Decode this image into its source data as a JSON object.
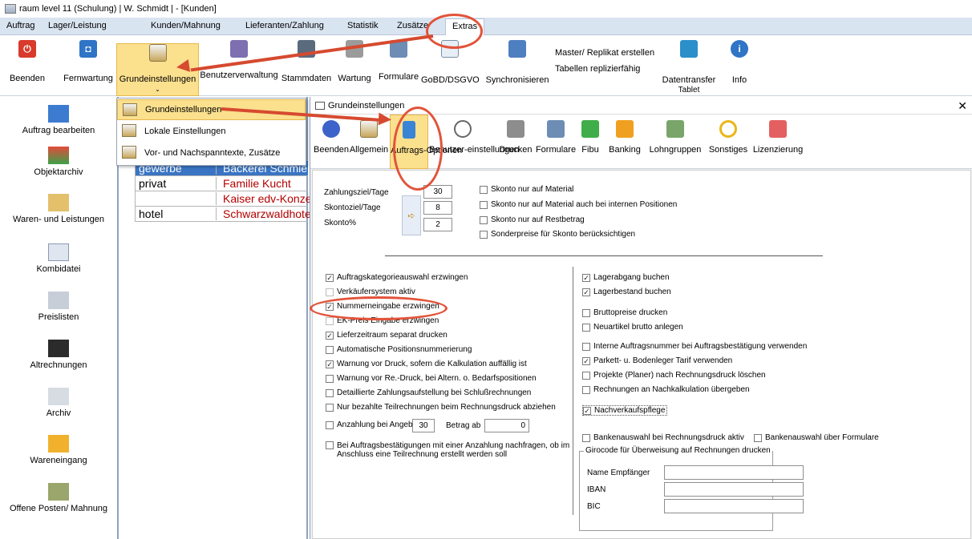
{
  "window": {
    "title": "raum level 11 (Schulung) | W. Schmidt | - [Kunden]"
  },
  "menubar": [
    "Auftrag",
    "Lager/Leistung",
    "Kunden/Mahnung",
    "Lieferanten/Zahlung",
    "Statistik",
    "Zusätze",
    "Extras"
  ],
  "ribbon": {
    "buttons": [
      "Beenden",
      "Fernwartung",
      "Grundeinstellungen",
      "Benutzerverwaltung",
      "Stammdaten",
      "Wartung",
      "Formulare",
      "GoBD/DSGVO",
      "Synchronisieren",
      "Datentransfer",
      "Info"
    ],
    "datentransfer_sub": "Tablet",
    "master_replikat": "Master/ Replikat erstellen",
    "tabellen_replizierfaehig": "Tabellen replizierfähig"
  },
  "dropdown": {
    "items": [
      "Grundeinstellungen",
      "Lokale Einstellungen",
      "Vor- und Nachspanntexte, Zusätze"
    ]
  },
  "left_nav": [
    "Auftrag bearbeiten",
    "Objektarchiv",
    "Waren- und Leistungen",
    "Kombidatei",
    "Preislisten",
    "Altrechnungen",
    "Archiv",
    "Wareneingang",
    "Offene Posten/ Mahnung"
  ],
  "customer_list": [
    {
      "type": "gewerbe",
      "name": "Bäckerei Schmie"
    },
    {
      "type": "privat",
      "name": "Familie Kucht"
    },
    {
      "type": "",
      "name": "Kaiser edv-Konze"
    },
    {
      "type": "hotel",
      "name": "Schwarzwaldhote"
    }
  ],
  "dialog": {
    "title": "Grundeinstellungen",
    "toolbar": [
      "Beenden",
      "Allgemein",
      "Auftrags-Optionen",
      "Benutzer-einstellungen",
      "Drucken",
      "Formulare",
      "Fibu",
      "Banking",
      "Lohngruppen",
      "Sonstiges",
      "Lizenzierung"
    ],
    "zahlung": {
      "zahlungsziel_label": "Zahlungsziel/Tage",
      "zahlungsziel": "30",
      "skontoziel_label": "Skontoziel/Tage",
      "skontoziel": "8",
      "skonto_label": "Skonto%",
      "skonto": "2"
    },
    "skonto_checks": [
      {
        "label": "Skonto nur auf Material",
        "checked": false
      },
      {
        "label": "Skonto nur auf Material auch bei internen Positionen",
        "checked": false
      },
      {
        "label": "Skonto nur auf Restbetrag",
        "checked": false
      },
      {
        "label": "Sonderpreise für Skonto berücksichtigen",
        "checked": false
      }
    ],
    "left_checks": [
      {
        "label": "Auftragskategorieauswahl erzwingen",
        "checked": true
      },
      {
        "label": "Verkäufersystem aktiv",
        "checked": false
      },
      {
        "label": "Nummerneingabe erzwingen",
        "checked": true
      },
      {
        "label": "EK-Preis Eingabe erzwingen",
        "checked": false
      },
      {
        "label": "Lieferzeitraum separat drucken",
        "checked": true
      },
      {
        "label": "Automatische Positionsnummerierung",
        "checked": false
      },
      {
        "label": "Warnung vor Druck, sofern die Kalkulation auffällig ist",
        "checked": true
      },
      {
        "label": "Warnung vor Re.-Druck, bei Altern. o. Bedarfspositionen",
        "checked": false
      },
      {
        "label": "Detaillierte Zahlungsaufstellung bei Schlußrechnungen",
        "checked": false
      },
      {
        "label": "Nur bezahlte Teilrechnungen beim Rechnungsdruck abziehen",
        "checked": false
      }
    ],
    "anzahlung": {
      "label": "Anzahlung bei Angebot",
      "value": "30",
      "betrag_label": "Betrag ab",
      "betrag": "0"
    },
    "nachfragen": "Bei Auftragsbestätigungen mit einer Anzahlung nachfragen, ob im Anschluss eine Teilrechnung erstellt werden soll",
    "right_checks": [
      {
        "label": "Lagerabgang buchen",
        "checked": true
      },
      {
        "label": "Lagerbestand buchen",
        "checked": true
      },
      {
        "label": "Bruttopreise drucken",
        "checked": false
      },
      {
        "label": "Neuartikel brutto anlegen",
        "checked": false
      },
      {
        "label": "Interne Auftragsnummer bei Auftragsbestätigung verwenden",
        "checked": false
      },
      {
        "label": "Parkett- u. Bodenleger Tarif verwenden",
        "checked": true
      },
      {
        "label": "Projekte (Planer) nach Rechnungsdruck löschen",
        "checked": false
      },
      {
        "label": "Rechnungen an Nachkalkulation übergeben",
        "checked": false
      },
      {
        "label": "Nachverkaufspflege",
        "checked": true
      }
    ],
    "bankenauswahl": [
      {
        "label": "Bankenauswahl bei Rechnungsdruck aktiv",
        "checked": false
      },
      {
        "label": "Bankenauswahl über Formulare",
        "checked": false
      }
    ],
    "girocode": {
      "group_label": "Girocode für Überweisung auf Rechnungen drucken",
      "name_label": "Name Empfänger",
      "iban_label": "IBAN",
      "bic_label": "BIC"
    }
  }
}
